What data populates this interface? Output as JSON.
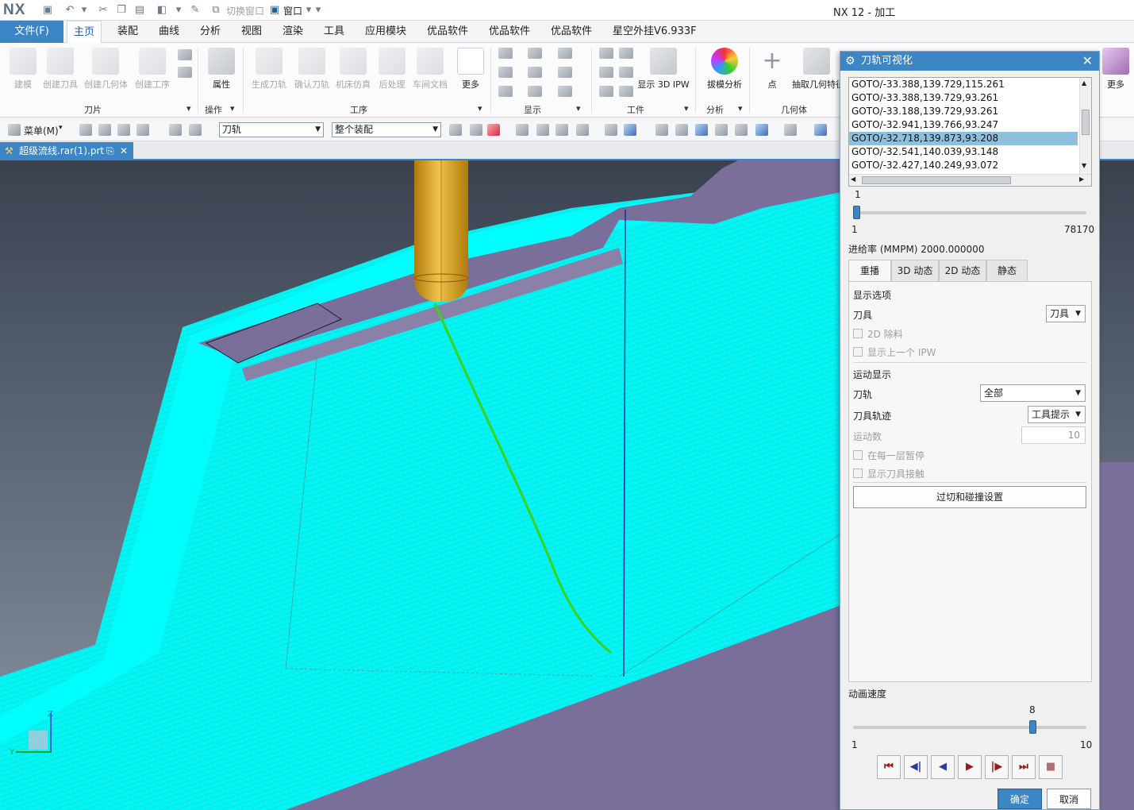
{
  "title_bar": {
    "logo": "NX",
    "switch_window": "切换窗口",
    "window_menu": "窗口",
    "app_title": "NX 12 - 加工"
  },
  "menu": {
    "file": "文件(F)",
    "tabs": [
      "主页",
      "装配",
      "曲线",
      "分析",
      "视图",
      "渲染",
      "工具",
      "应用模块",
      "优品软件",
      "优品软件",
      "优品软件",
      "星空外挂V6.933F"
    ]
  },
  "ribbon": {
    "buttons": [
      "建模",
      "创建刀具",
      "创建几何体",
      "创建工序",
      "属性",
      "生成刀轨",
      "确认刀轨",
      "机床仿真",
      "后处理",
      "车间文档",
      "更多",
      "显示 3D IPW",
      "拔模分析",
      "点",
      "抽取几何特征",
      "更多"
    ],
    "groups": [
      "刀片",
      "操作",
      "工序",
      "显示",
      "工件",
      "分析",
      "几何体"
    ]
  },
  "toolbar2": {
    "menu": "菜单(M)",
    "filter_combo": "刀轨",
    "scope_combo": "整个装配"
  },
  "doc_tab": {
    "name": "超级流线.rar(1).prt"
  },
  "viewport": {
    "axis_z": "Z",
    "axis_y": "Y"
  },
  "dialog": {
    "title": "刀轨可视化",
    "goto_lines": [
      "GOTO/-33.388,139.729,115.261",
      "GOTO/-33.388,139.729,93.261",
      "GOTO/-33.188,139.729,93.261",
      "GOTO/-32.941,139.766,93.247",
      "GOTO/-32.718,139.873,93.208",
      "GOTO/-32.541,140.039,93.148",
      "GOTO/-32.427,140.249,93.072"
    ],
    "selected_index": 4,
    "position_slider": {
      "value": "1",
      "min": "1",
      "max": "78170",
      "fraction": 0.0
    },
    "feed_rate": "进给率 (MMPM) 2000.000000",
    "tabs": [
      "重播",
      "3D 动态",
      "2D 动态",
      "静态"
    ],
    "display_options": {
      "header": "显示选项",
      "tool_label": "刀具",
      "tool_value": "刀具",
      "remove_2d": "2D 除料",
      "show_prev_ipw": "显示上一个 IPW"
    },
    "motion_display": {
      "header": "运动显示",
      "path_label": "刀轨",
      "path_value": "全部",
      "trace_label": "刀具轨迹",
      "trace_value": "工具提示",
      "motion_count_label": "运动数",
      "motion_count_value": "10",
      "pause_each_layer": "在每一层暂停",
      "show_tool_contact": "显示刀具接触"
    },
    "gouge_button": "过切和碰撞设置",
    "speed": {
      "label": "动画速度",
      "value": "8",
      "min": "1",
      "max": "10",
      "fraction": 0.78
    },
    "ok": "确定",
    "cancel": "取消"
  },
  "colors": {
    "accent": "#3c86c6",
    "toolpath": "#00ffff",
    "part": "#7a6f9a",
    "tool": "#d9a21b"
  }
}
